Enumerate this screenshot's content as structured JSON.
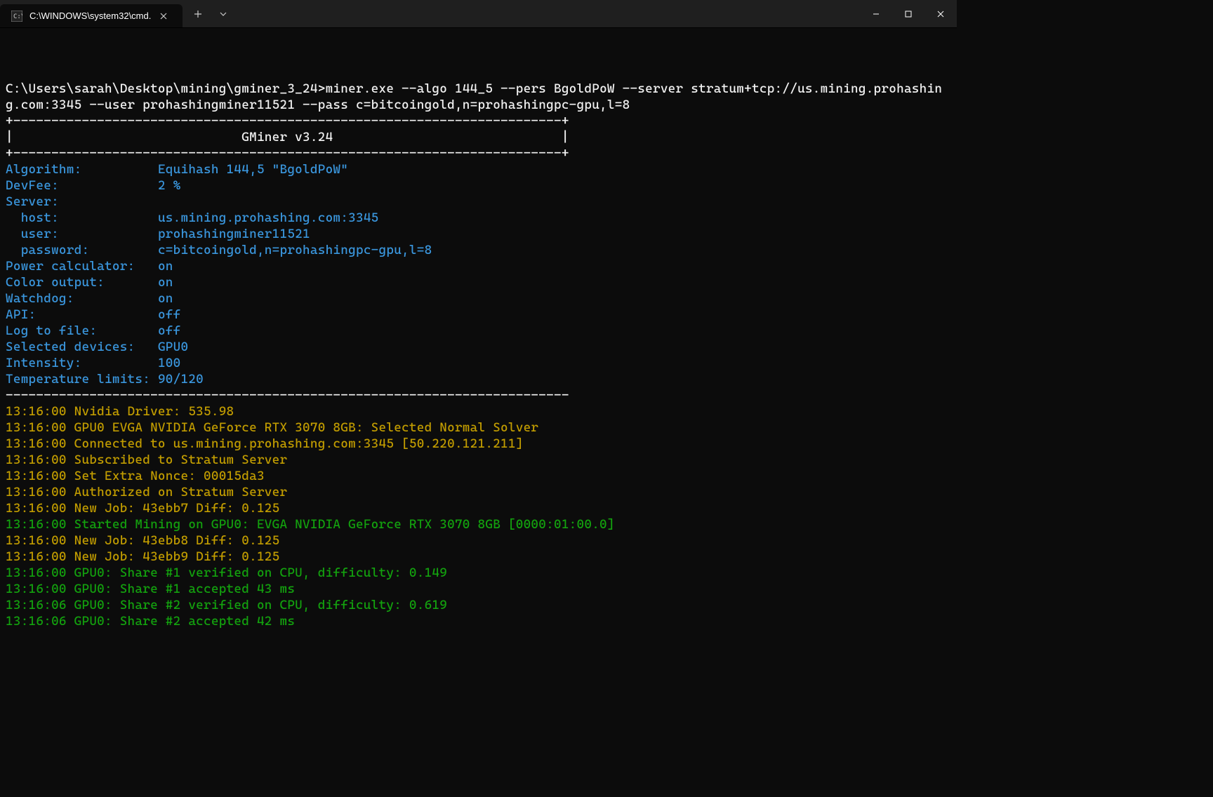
{
  "titlebar": {
    "tab_title": "C:\\WINDOWS\\system32\\cmd."
  },
  "prompt": {
    "path": "C:\\Users\\sarah\\Desktop\\mining\\gminer_3_24>",
    "command": "miner.exe --algo 144_5 --pers BgoldPoW --server stratum+tcp://us.mining.prohashing.com:3345 --user prohashingminer11521 --pass c=bitcoingold,n=prohashingpc-gpu,l=8"
  },
  "banner": {
    "border_top": "+------------------------------------------------------------------------+",
    "title_line": "|                              GMiner v3.24                              |",
    "border_bottom": "+------------------------------------------------------------------------+"
  },
  "info": [
    {
      "label": "Algorithm:          ",
      "value": "Equihash 144,5 \"BgoldPoW\""
    },
    {
      "label": "DevFee:             ",
      "value": "2 %"
    },
    {
      "label": "Server:",
      "value": ""
    },
    {
      "label": "  host:             ",
      "value": "us.mining.prohashing.com:3345"
    },
    {
      "label": "  user:             ",
      "value": "prohashingminer11521"
    },
    {
      "label": "  password:         ",
      "value": "c=bitcoingold,n=prohashingpc-gpu,l=8"
    },
    {
      "label": "Power calculator:   ",
      "value": "on"
    },
    {
      "label": "Color output:       ",
      "value": "on"
    },
    {
      "label": "Watchdog:           ",
      "value": "on"
    },
    {
      "label": "API:                ",
      "value": "off"
    },
    {
      "label": "Log to file:        ",
      "value": "off"
    },
    {
      "label": "Selected devices:   ",
      "value": "GPU0"
    },
    {
      "label": "Intensity:          ",
      "value": "100"
    },
    {
      "label": "Temperature limits: ",
      "value": "90/120"
    }
  ],
  "divider": "--------------------------------------------------------------------------",
  "log": [
    {
      "color": "yellow",
      "text": "13:16:00 Nvidia Driver: 535.98"
    },
    {
      "color": "yellow",
      "text": "13:16:00 GPU0 EVGA NVIDIA GeForce RTX 3070 8GB: Selected Normal Solver"
    },
    {
      "color": "yellow",
      "text": "13:16:00 Connected to us.mining.prohashing.com:3345 [50.220.121.211]"
    },
    {
      "color": "yellow",
      "text": "13:16:00 Subscribed to Stratum Server"
    },
    {
      "color": "yellow",
      "text": "13:16:00 Set Extra Nonce: 00015da3"
    },
    {
      "color": "yellow",
      "text": "13:16:00 Authorized on Stratum Server"
    },
    {
      "color": "yellow",
      "text": "13:16:00 New Job: 43ebb7 Diff: 0.125"
    },
    {
      "color": "green",
      "text": "13:16:00 Started Mining on GPU0: EVGA NVIDIA GeForce RTX 3070 8GB [0000:01:00.0]"
    },
    {
      "color": "yellow",
      "text": "13:16:00 New Job: 43ebb8 Diff: 0.125"
    },
    {
      "color": "yellow",
      "text": "13:16:00 New Job: 43ebb9 Diff: 0.125"
    },
    {
      "color": "green",
      "text": "13:16:00 GPU0: Share #1 verified on CPU, difficulty: 0.149"
    },
    {
      "color": "green",
      "text": "13:16:00 GPU0: Share #1 accepted 43 ms"
    },
    {
      "color": "green",
      "text": "13:16:06 GPU0: Share #2 verified on CPU, difficulty: 0.619"
    },
    {
      "color": "green",
      "text": "13:16:06 GPU0: Share #2 accepted 42 ms"
    }
  ]
}
